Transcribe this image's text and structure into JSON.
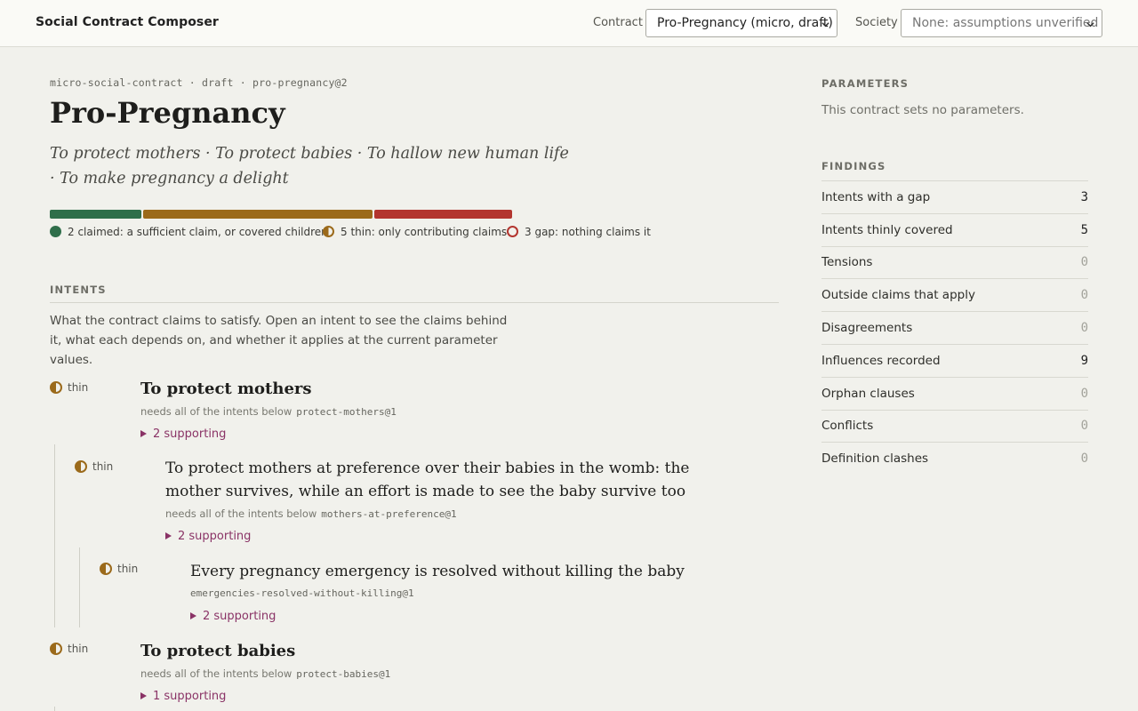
{
  "header": {
    "app_title": "Social Contract Composer",
    "contract_label": "Contract",
    "contract_value": "Pro-Pregnancy (micro, draft)",
    "society_label": "Society",
    "society_value": "None: assumptions unverified"
  },
  "contract": {
    "meta": "micro-social-contract · draft · pro-pregnancy@2",
    "title": "Pro-Pregnancy",
    "subtitle": "To protect mothers · To protect babies · To hallow new human life · To make pregnancy a delight"
  },
  "coverage": {
    "colors": {
      "claimed": "#2f6e4a",
      "thin": "#9b6a1b",
      "gap": "#b3352f"
    },
    "legend": {
      "claimed": "2 claimed: a sufficient claim, or covered children",
      "thin": "5 thin: only contributing claims",
      "gap": "3 gap: nothing claims it"
    }
  },
  "intents_section": {
    "heading": "INTENTS",
    "description": "What the contract claims to satisfy. Open an intent to see the claims behind it, what each depends on, and whether it applies at the current parameter values."
  },
  "intents": [
    {
      "status": "thin",
      "title": "To protect mothers",
      "needs": "needs all of the intents below",
      "code": "protect-mothers@1",
      "supporting": "2 supporting"
    },
    {
      "status": "thin",
      "title": "To protect mothers at preference over their babies in the womb: the mother survives, while an effort is made to see the baby survive too",
      "needs": "needs all of the intents below",
      "code": "mothers-at-preference@1",
      "supporting": "2 supporting"
    },
    {
      "status": "thin",
      "title": "Every pregnancy emergency is resolved without killing the baby",
      "code": "emergencies-resolved-without-killing@1",
      "supporting": "2 supporting"
    },
    {
      "status": "thin",
      "title": "To protect babies",
      "needs": "needs all of the intents below",
      "code": "protect-babies@1",
      "supporting": "1 supporting"
    }
  ],
  "sidebar": {
    "parameters_heading": "PARAMETERS",
    "parameters_note": "This contract sets no parameters.",
    "findings_heading": "FINDINGS",
    "findings": [
      {
        "label": "Intents with a gap",
        "value": "3"
      },
      {
        "label": "Intents thinly covered",
        "value": "5"
      },
      {
        "label": "Tensions",
        "value": "0"
      },
      {
        "label": "Outside claims that apply",
        "value": "0"
      },
      {
        "label": "Disagreements",
        "value": "0"
      },
      {
        "label": "Influences recorded",
        "value": "9"
      },
      {
        "label": "Orphan clauses",
        "value": "0"
      },
      {
        "label": "Conflicts",
        "value": "0"
      },
      {
        "label": "Definition clashes",
        "value": "0"
      }
    ]
  }
}
